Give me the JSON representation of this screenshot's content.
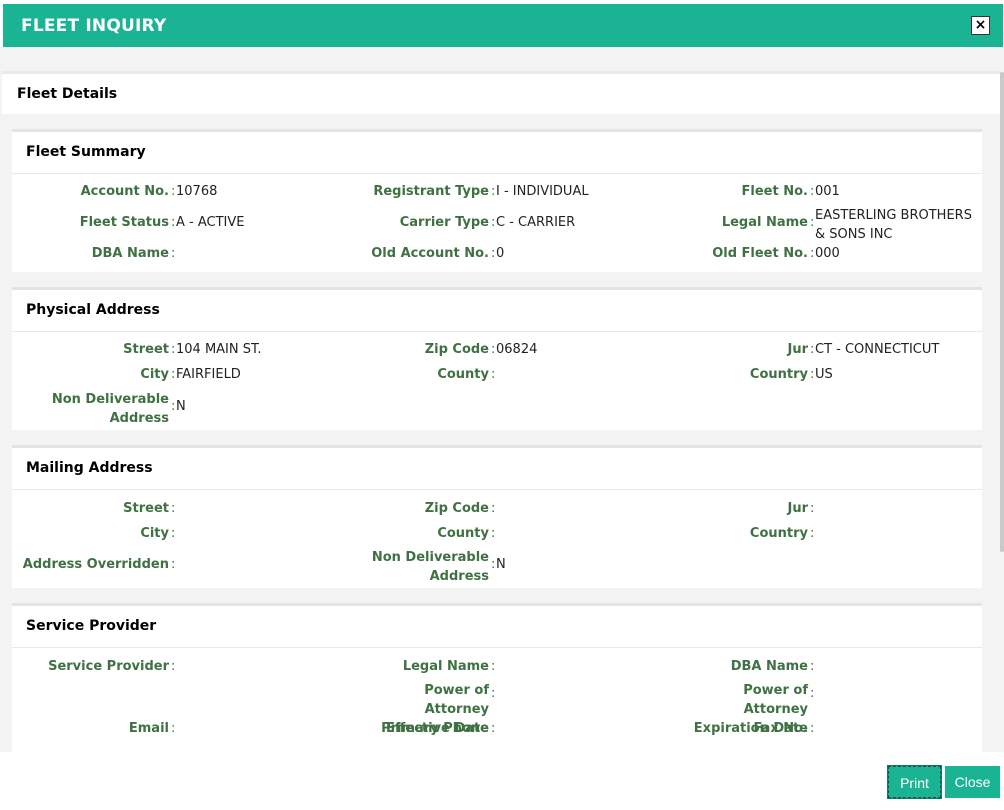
{
  "dialog": {
    "title": "FLEET INQUIRY",
    "close_glyph": "×"
  },
  "details": {
    "heading": "Fleet Details"
  },
  "fleet_summary": {
    "heading": "Fleet Summary",
    "account_no": {
      "label": "Account No.",
      "value": "10768"
    },
    "registrant_type": {
      "label": "Registrant Type",
      "value": "I - INDIVIDUAL"
    },
    "fleet_no": {
      "label": "Fleet No.",
      "value": "001"
    },
    "fleet_status": {
      "label": "Fleet Status",
      "value": "A - ACTIVE"
    },
    "carrier_type": {
      "label": "Carrier Type",
      "value": "C - CARRIER"
    },
    "legal_name": {
      "label": "Legal Name",
      "value": "EASTERLING BROTHERS & SONS INC"
    },
    "dba_name": {
      "label": "DBA Name",
      "value": ""
    },
    "old_account_no": {
      "label": "Old Account No.",
      "value": "0"
    },
    "old_fleet_no": {
      "label": "Old Fleet No.",
      "value": "000"
    }
  },
  "physical_address": {
    "heading": "Physical Address",
    "street": {
      "label": "Street",
      "value": "104 MAIN ST."
    },
    "zip": {
      "label": "Zip Code",
      "value": "06824"
    },
    "jur": {
      "label": "Jur",
      "value": "CT - CONNECTICUT"
    },
    "city": {
      "label": "City",
      "value": "FAIRFIELD"
    },
    "county": {
      "label": "County",
      "value": ""
    },
    "country": {
      "label": "Country",
      "value": "US"
    },
    "non_deliverable": {
      "label": "Non Deliverable Address",
      "value": "N"
    }
  },
  "mailing_address": {
    "heading": "Mailing Address",
    "street": {
      "label": "Street",
      "value": ""
    },
    "zip": {
      "label": "Zip Code",
      "value": ""
    },
    "jur": {
      "label": "Jur",
      "value": ""
    },
    "city": {
      "label": "City",
      "value": ""
    },
    "county": {
      "label": "County",
      "value": ""
    },
    "country": {
      "label": "Country",
      "value": ""
    },
    "address_overridden": {
      "label": "Address Overridden",
      "value": ""
    },
    "non_deliverable": {
      "label": "Non Deliverable Address",
      "value": "N"
    }
  },
  "service_provider": {
    "heading": "Service Provider",
    "service_provider": {
      "label": "Service Provider",
      "value": ""
    },
    "legal_name": {
      "label": "Legal Name",
      "value": ""
    },
    "dba_name": {
      "label": "DBA Name",
      "value": ""
    },
    "poa_effective": {
      "label": "Power of Attorney Effective Date",
      "value": ""
    },
    "poa_expiration": {
      "label": "Power of Attorney Expiration Date",
      "value": ""
    },
    "email": {
      "label": "Email",
      "value": ""
    },
    "primary_phone": {
      "label": "Primary Phone",
      "value": ""
    },
    "fax_no": {
      "label": "Fax No.",
      "value": ""
    }
  },
  "footer": {
    "print_label": "Print",
    "close_label": "Close"
  },
  "colors": {
    "accent": "#1ab394",
    "label_green": "#3f7143"
  }
}
